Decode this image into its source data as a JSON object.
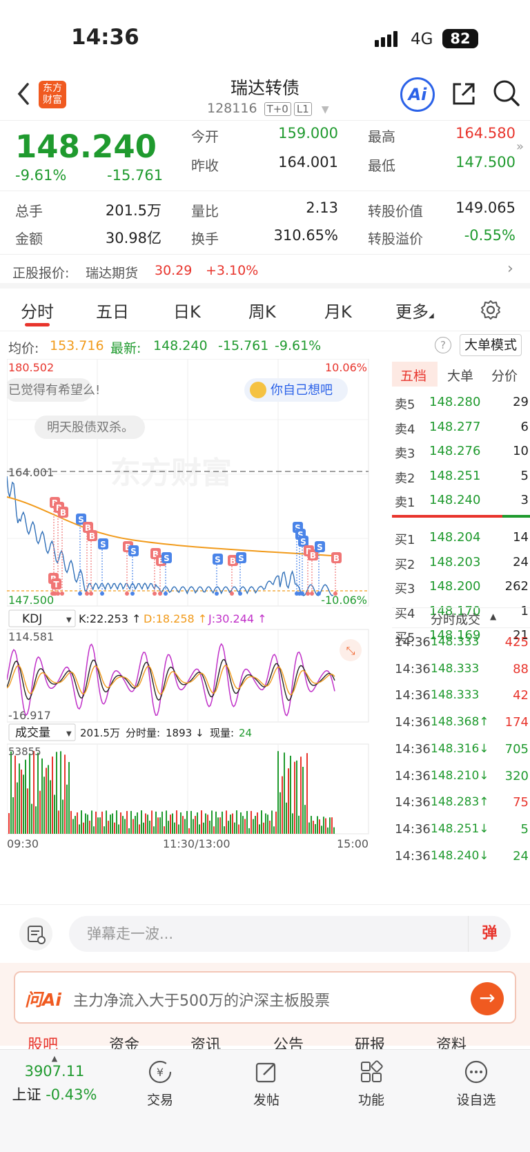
{
  "status_bar": {
    "time": "14:36",
    "network": "4G",
    "battery": "82"
  },
  "nav": {
    "back_icon": "chevron-left-icon",
    "logo_text": "东方\n财富",
    "title": "瑞达转债",
    "code": "128116",
    "tag1": "T+0",
    "tag2": "L1",
    "ai_label": "Ai"
  },
  "quote": {
    "price": "148.240",
    "change_pct": "-9.61%",
    "change": "-15.761",
    "open_label": "今开",
    "open": "159.000",
    "prev_close_label": "昨收",
    "prev_close": "164.001",
    "high_label": "最高",
    "high": "164.580",
    "low_label": "最低",
    "low": "147.500",
    "volume_label": "总手",
    "volume": "201.5万",
    "amount_label": "金额",
    "amount": "30.98亿",
    "vol_ratio_label": "量比",
    "vol_ratio": "2.13",
    "turnover_label": "换手",
    "turnover": "310.65%",
    "conv_value_label": "转股价值",
    "conv_value": "149.065",
    "conv_premium_label": "转股溢价",
    "conv_premium": "-0.55%"
  },
  "underlying": {
    "label": "正股报价:",
    "name": "瑞达期货",
    "price": "30.29",
    "change_pct": "+3.10%"
  },
  "tabs": [
    "分时",
    "五日",
    "日K",
    "周K",
    "月K",
    "更多"
  ],
  "avg_bar": {
    "avg_label": "均价:",
    "avg": "153.716",
    "latest_label": "最新:",
    "latest": "148.240",
    "change": "-15.761",
    "change_pct": "-9.61%",
    "big_order_mode": "大单模式"
  },
  "chart": {
    "price_max": "180.502",
    "price_max_pct": "10.06%",
    "prev_close_line": "164.001",
    "price_min": "147.500",
    "price_min_pct": "-10.06%",
    "watermark": "东方财富",
    "danmu1": "已觉得有希望么!",
    "danmu2": "你自己想吧",
    "danmu3": "明天股债双杀。",
    "kdj_label": "KDJ",
    "kdj_k": "K:22.253 ↑",
    "kdj_d": "D:18.258 ↑",
    "kdj_j": "J:30.244 ↑",
    "kdj_max": "114.581",
    "kdj_min": "-16.917",
    "vol_label": "成交量",
    "vol_total": "201.5万",
    "vol_min_label": "分时量:",
    "vol_min": "1893 ↓",
    "vol_now_label": "现量:",
    "vol_now": "24",
    "vol_max": "53855",
    "time_start": "09:30",
    "time_mid": "11:30/13:00",
    "time_end": "15:00"
  },
  "depth": {
    "tabs": [
      "五档",
      "大单",
      "分价"
    ],
    "asks": [
      {
        "label": "卖5",
        "price": "148.280",
        "vol": "29"
      },
      {
        "label": "卖4",
        "price": "148.277",
        "vol": "6"
      },
      {
        "label": "卖3",
        "price": "148.276",
        "vol": "10"
      },
      {
        "label": "卖2",
        "price": "148.251",
        "vol": "5"
      },
      {
        "label": "卖1",
        "price": "148.240",
        "vol": "3"
      }
    ],
    "bids": [
      {
        "label": "买1",
        "price": "148.204",
        "vol": "14"
      },
      {
        "label": "买2",
        "price": "148.203",
        "vol": "24"
      },
      {
        "label": "买3",
        "price": "148.200",
        "vol": "262"
      },
      {
        "label": "买4",
        "price": "148.170",
        "vol": "1"
      },
      {
        "label": "买5",
        "price": "148.169",
        "vol": "21"
      }
    ],
    "trades_title": "分时成交",
    "trades": [
      {
        "time": "14:36",
        "price": "148.333",
        "vol": "425",
        "dir": ""
      },
      {
        "time": "14:36",
        "price": "148.333",
        "vol": "88",
        "dir": ""
      },
      {
        "time": "14:36",
        "price": "148.333",
        "vol": "42",
        "dir": ""
      },
      {
        "time": "14:36",
        "price": "148.368↑",
        "vol": "174",
        "dir": "up"
      },
      {
        "time": "14:36",
        "price": "148.316↓",
        "vol": "705",
        "dir": "down"
      },
      {
        "time": "14:36",
        "price": "148.210↓",
        "vol": "320",
        "dir": "down"
      },
      {
        "time": "14:36",
        "price": "148.283↑",
        "vol": "75",
        "dir": "up"
      },
      {
        "time": "14:36",
        "price": "148.251↓",
        "vol": "5",
        "dir": "down"
      },
      {
        "time": "14:36",
        "price": "148.240↓",
        "vol": "24",
        "dir": "down"
      }
    ]
  },
  "input": {
    "placeholder": "弹幕走一波...",
    "danmu_btn": "弹"
  },
  "ai_banner": {
    "logo": "问Ai",
    "text": "主力净流入大于500万的沪深主板股票"
  },
  "clipped_tabs": [
    "股吧",
    "资金",
    "资讯",
    "公告",
    "研报",
    "资料"
  ],
  "bottom_nav": {
    "index_value": "3907.11",
    "index_name": "上证",
    "index_pct": "-0.43%",
    "items": [
      "交易",
      "发帖",
      "功能",
      "设自选"
    ]
  },
  "colors": {
    "up": "#e8342c",
    "down": "#1f9a2e",
    "avg": "#f19a1a",
    "price_line": "#2f6fb8",
    "brand": "#f05a20"
  }
}
